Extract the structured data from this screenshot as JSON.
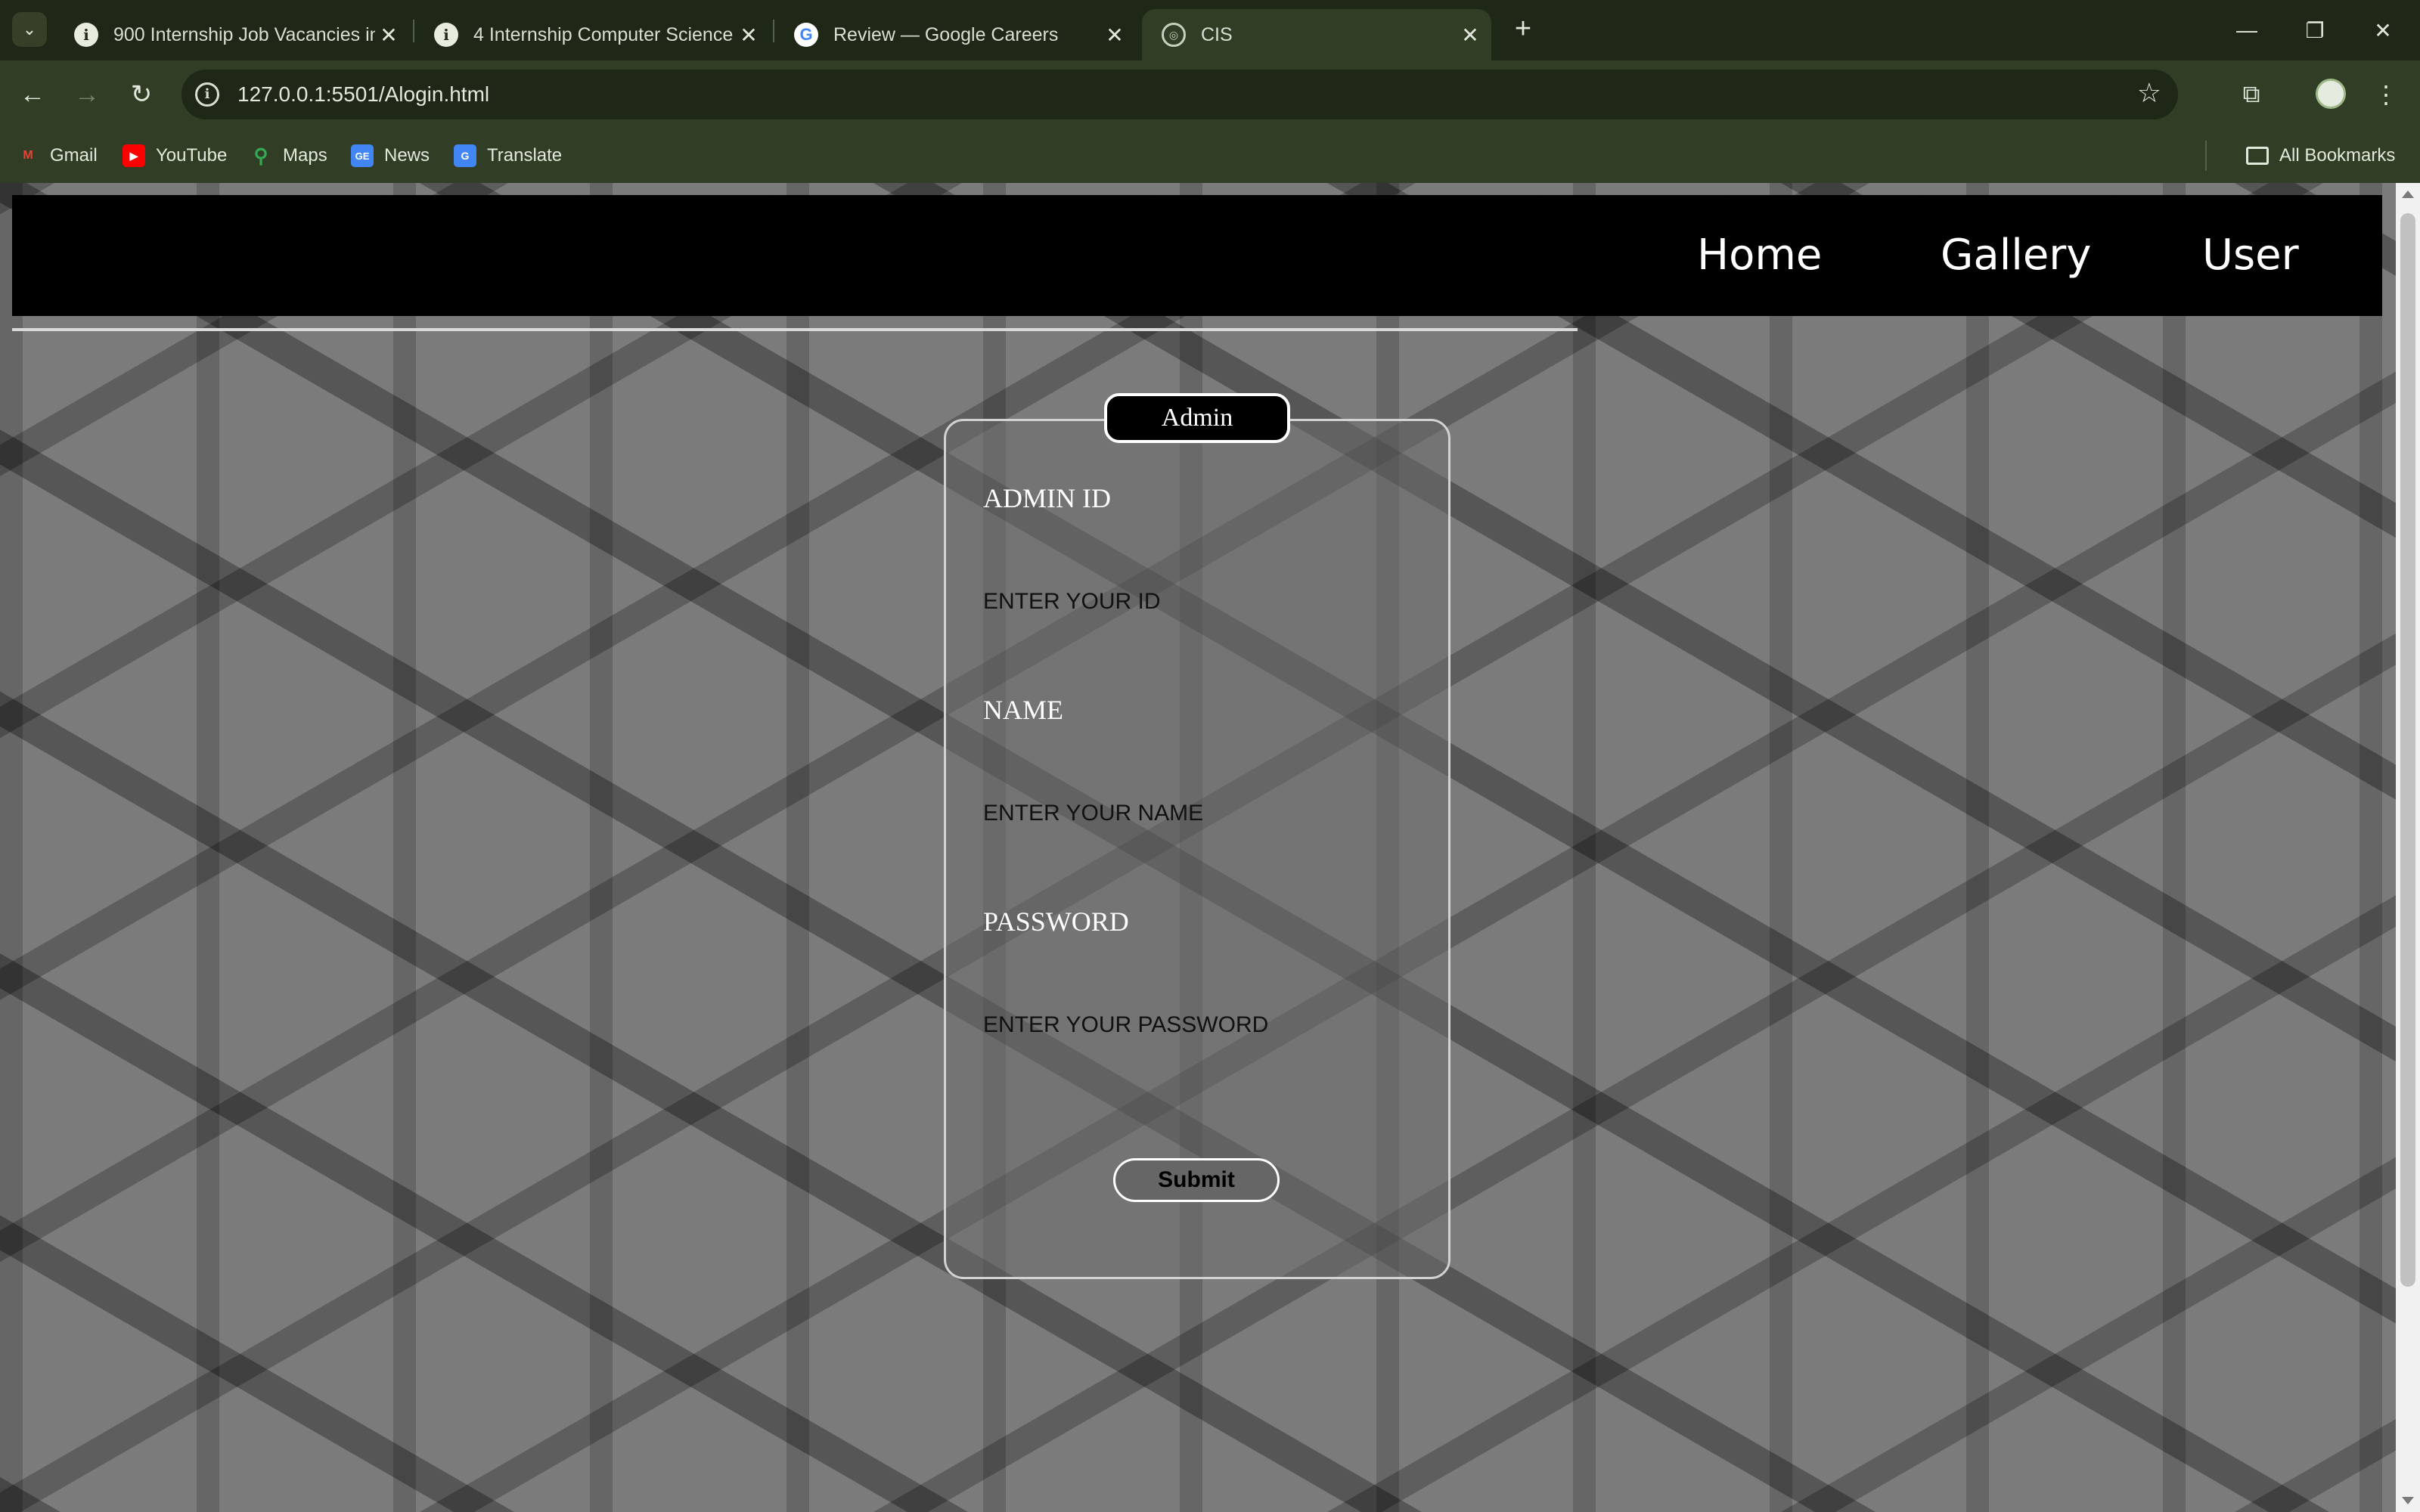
{
  "browser": {
    "tabs": [
      {
        "title": "900 Internship Job Vacancies in",
        "favicon": "info-icon",
        "active": false
      },
      {
        "title": "4 Internship Computer Science",
        "favicon": "info-icon",
        "active": false
      },
      {
        "title": "Review — Google Careers",
        "favicon": "google-icon",
        "active": false
      },
      {
        "title": "CIS",
        "favicon": "globe-icon",
        "active": true
      }
    ],
    "url": "127.0.0.1:5501/Alogin.html",
    "bookmarks": [
      {
        "label": "Gmail",
        "icon": "gmail-icon"
      },
      {
        "label": "YouTube",
        "icon": "youtube-icon"
      },
      {
        "label": "Maps",
        "icon": "maps-icon"
      },
      {
        "label": "News",
        "icon": "news-icon"
      },
      {
        "label": "Translate",
        "icon": "translate-icon"
      }
    ],
    "all_bookmarks_label": "All Bookmarks"
  },
  "site": {
    "nav": [
      {
        "label": "Home"
      },
      {
        "label": "Gallery"
      },
      {
        "label": "User"
      }
    ]
  },
  "form": {
    "legend": "Admin",
    "fields": [
      {
        "label": "ADMIN ID",
        "placeholder": "ENTER YOUR ID"
      },
      {
        "label": "NAME",
        "placeholder": "ENTER YOUR NAME"
      },
      {
        "label": "PASSWORD",
        "placeholder": "ENTER YOUR PASSWORD"
      }
    ],
    "submit_label": "Submit"
  },
  "colors": {
    "chrome_dark": "#1f2717",
    "chrome_toolbar": "#323d25",
    "site_nav_bg": "#000000",
    "text_light": "#ffffff"
  }
}
